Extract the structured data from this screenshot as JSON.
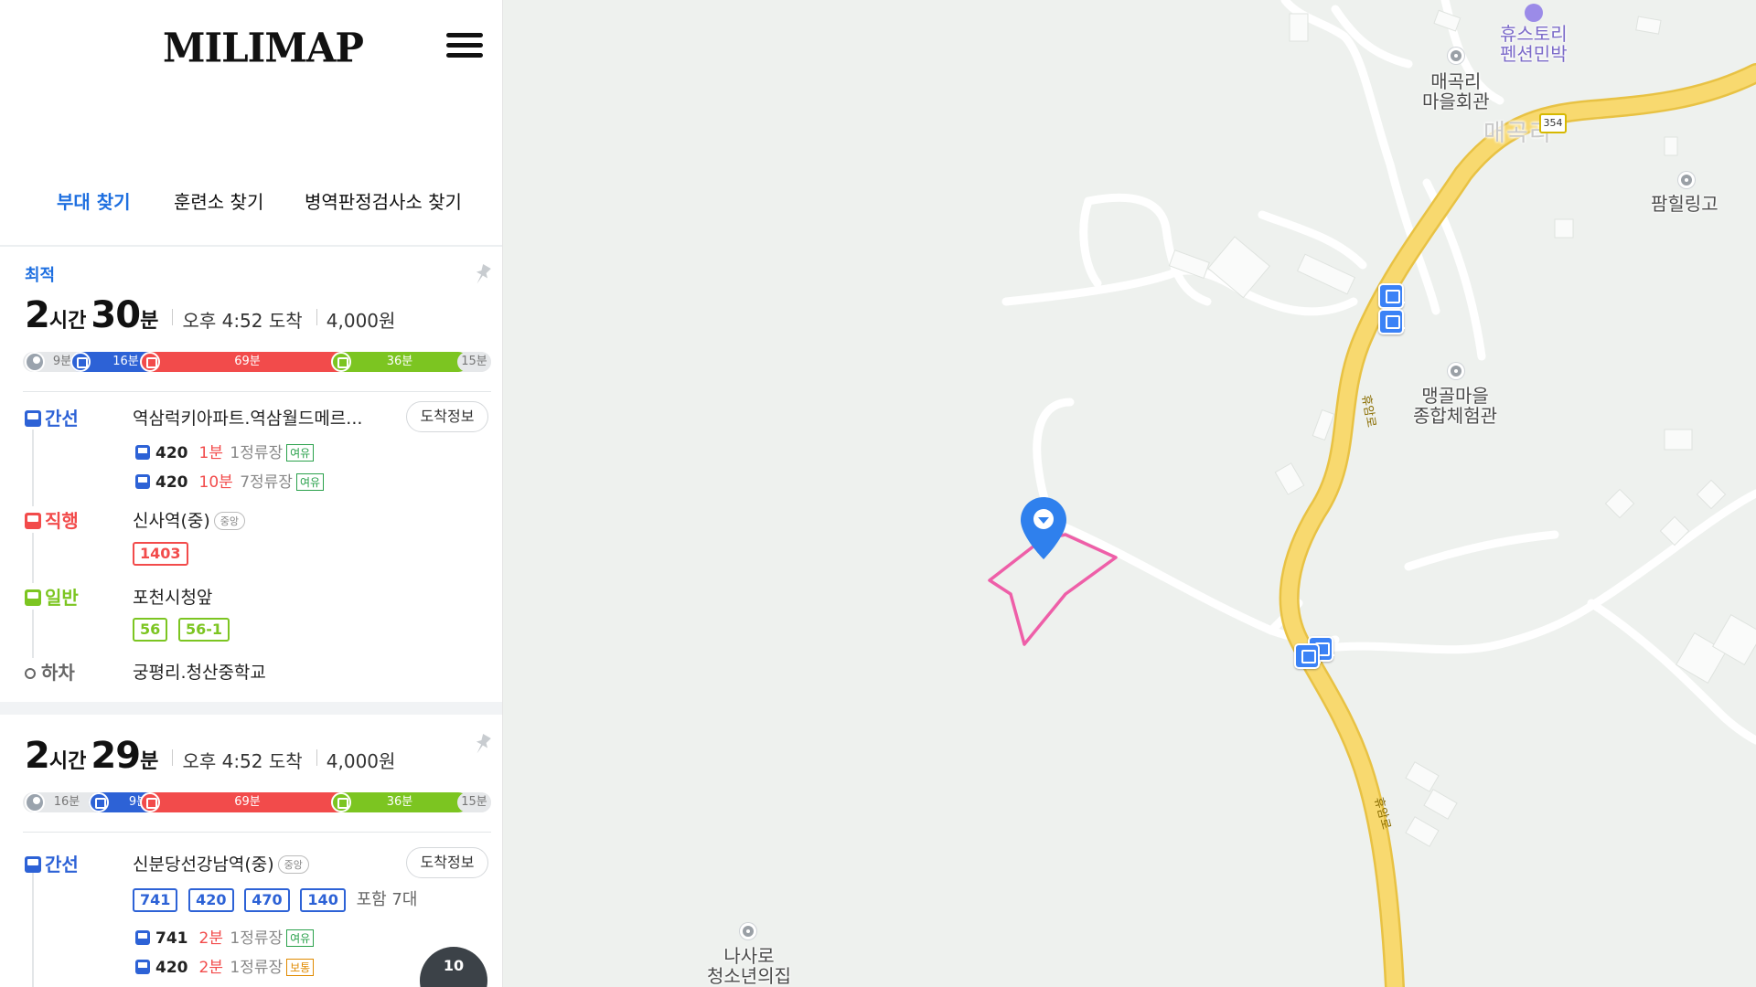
{
  "app": {
    "logo": "MILIMAP"
  },
  "tabs": [
    {
      "label": "부대 찾기",
      "active": true
    },
    {
      "label": "훈련소 찾기",
      "active": false
    },
    {
      "label": "병역판정검사소 찾기",
      "active": false
    }
  ],
  "routes": [
    {
      "badge": "최적",
      "hours": "2",
      "hours_unit": "시간",
      "minutes": "30",
      "minutes_unit": "분",
      "arrival": "오후 4:52 도착",
      "fare": "4,000원",
      "segments": [
        {
          "mode": "walk",
          "label": "9분"
        },
        {
          "mode": "bus-blue",
          "label": "16분"
        },
        {
          "mode": "bus-red",
          "label": "69분"
        },
        {
          "mode": "bus-green",
          "label": "36분"
        },
        {
          "mode": "walk",
          "label": "15분"
        }
      ],
      "steps": [
        {
          "type": "간선",
          "station": "역삼럭키아파트.역삼월드메르...",
          "arrive_label": "도착정보",
          "arrivals": [
            {
              "route": "420",
              "minutes": "1분",
              "stops": "1정류장",
              "seat": "여유"
            },
            {
              "route": "420",
              "minutes": "10분",
              "stops": "7정류장",
              "seat": "여유"
            }
          ]
        },
        {
          "type": "직행",
          "station": "신사역(중)",
          "station_tag": "중앙",
          "routes": [
            "1403"
          ]
        },
        {
          "type": "일반",
          "station": "포천시청앞",
          "routes": [
            "56",
            "56-1"
          ]
        },
        {
          "type": "하차",
          "station": "궁평리.청산중학교"
        }
      ]
    },
    {
      "hours": "2",
      "hours_unit": "시간",
      "minutes": "29",
      "minutes_unit": "분",
      "arrival": "오후 4:52 도착",
      "fare": "4,000원",
      "segments": [
        {
          "mode": "walk",
          "label": "16분"
        },
        {
          "mode": "bus-blue",
          "label": "9분"
        },
        {
          "mode": "bus-red",
          "label": "69분"
        },
        {
          "mode": "bus-green",
          "label": "36분"
        },
        {
          "mode": "walk",
          "label": "15분"
        }
      ],
      "steps": [
        {
          "type": "간선",
          "station": "신분당선강남역(중)",
          "station_tag": "중앙",
          "arrive_label": "도착정보",
          "routes": [
            "741",
            "420",
            "470",
            "140"
          ],
          "routes_more": "포함 7대",
          "arrivals": [
            {
              "route": "741",
              "minutes": "2분",
              "stops": "1정류장",
              "seat": "여유"
            },
            {
              "route": "420",
              "minutes": "2분",
              "stops": "1정류장",
              "seat": "보통"
            }
          ]
        }
      ]
    }
  ],
  "float_button": {
    "label": "10"
  },
  "map": {
    "labels": {
      "pension": "휴스토리\n펜션민박",
      "village_hall": "매곡리\n마을회관",
      "area": "매곡리",
      "pamhill": "팜힐링고",
      "experience": "맹골마을\n종합체험관",
      "youth_house": "나사로\n청소년의집",
      "road1": "휴암로",
      "road2": "휴암로",
      "shield": "354"
    },
    "colors": {
      "road": "#f5d66e",
      "accent": "#1e6fe0",
      "boundary": "#ee5fa8"
    }
  }
}
